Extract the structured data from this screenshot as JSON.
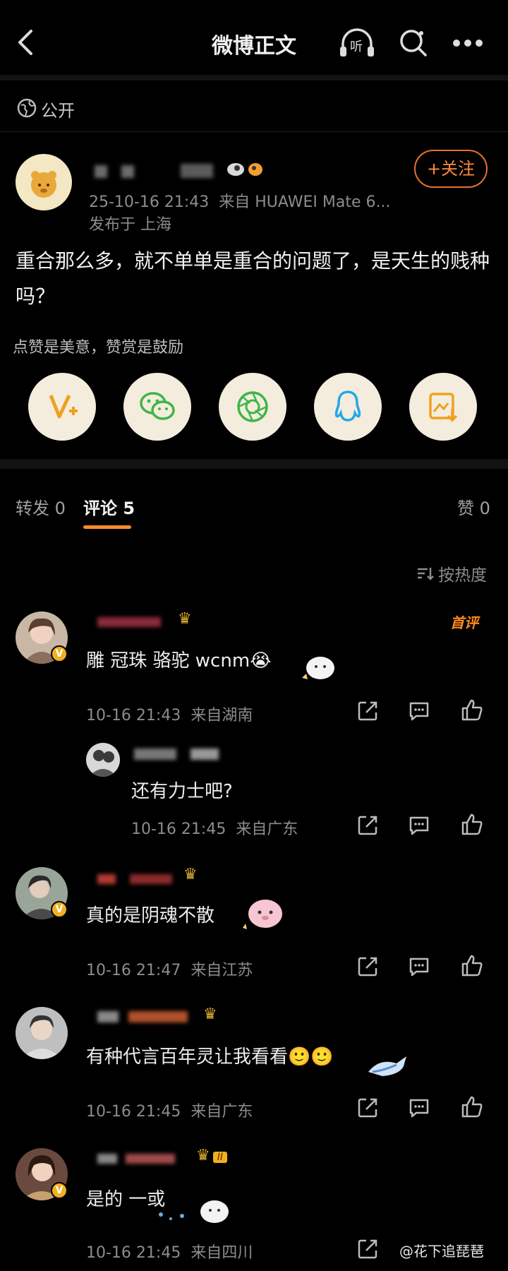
{
  "header": {
    "title": "微博正文",
    "listen_label": "听"
  },
  "visibility": {
    "label": "公开"
  },
  "post": {
    "meta_time": "25-10-16 21:43",
    "meta_source": "来自 HUAWEI Mate 6...",
    "location": "发布于 上海",
    "content": "重合那么多，就不单单是重合的问题了，是天生的贱种吗？",
    "follow_label": "+关注"
  },
  "reward": {
    "slogan": "点赞是美意，赞赏是鼓励"
  },
  "share_icons": [
    "v-plus-icon",
    "wechat-icon",
    "moments-icon",
    "qq-icon",
    "save-image-icon"
  ],
  "tabs": {
    "repost": "转发 0",
    "comments": "评论 5",
    "likes": "赞 0"
  },
  "sort": {
    "label": "按热度"
  },
  "comments": [
    {
      "text": "雕 冠珠 骆驼 wcnm😭",
      "time": "10-16 21:43",
      "source": "来自湖南",
      "badge": "首评"
    },
    {
      "text": "还有力士吧?",
      "time": "10-16 21:45",
      "source": "来自广东"
    },
    {
      "text": "真的是阴魂不散",
      "time": "10-16 21:47",
      "source": "来自江苏"
    },
    {
      "text": "有种代言百年灵让我看看🙂🙂",
      "time": "10-16 21:45",
      "source": "来自广东"
    },
    {
      "text": "是的 一或",
      "time": "10-16 21:45",
      "source": "来自四川"
    }
  ],
  "watermark": "@花下追琵琶"
}
